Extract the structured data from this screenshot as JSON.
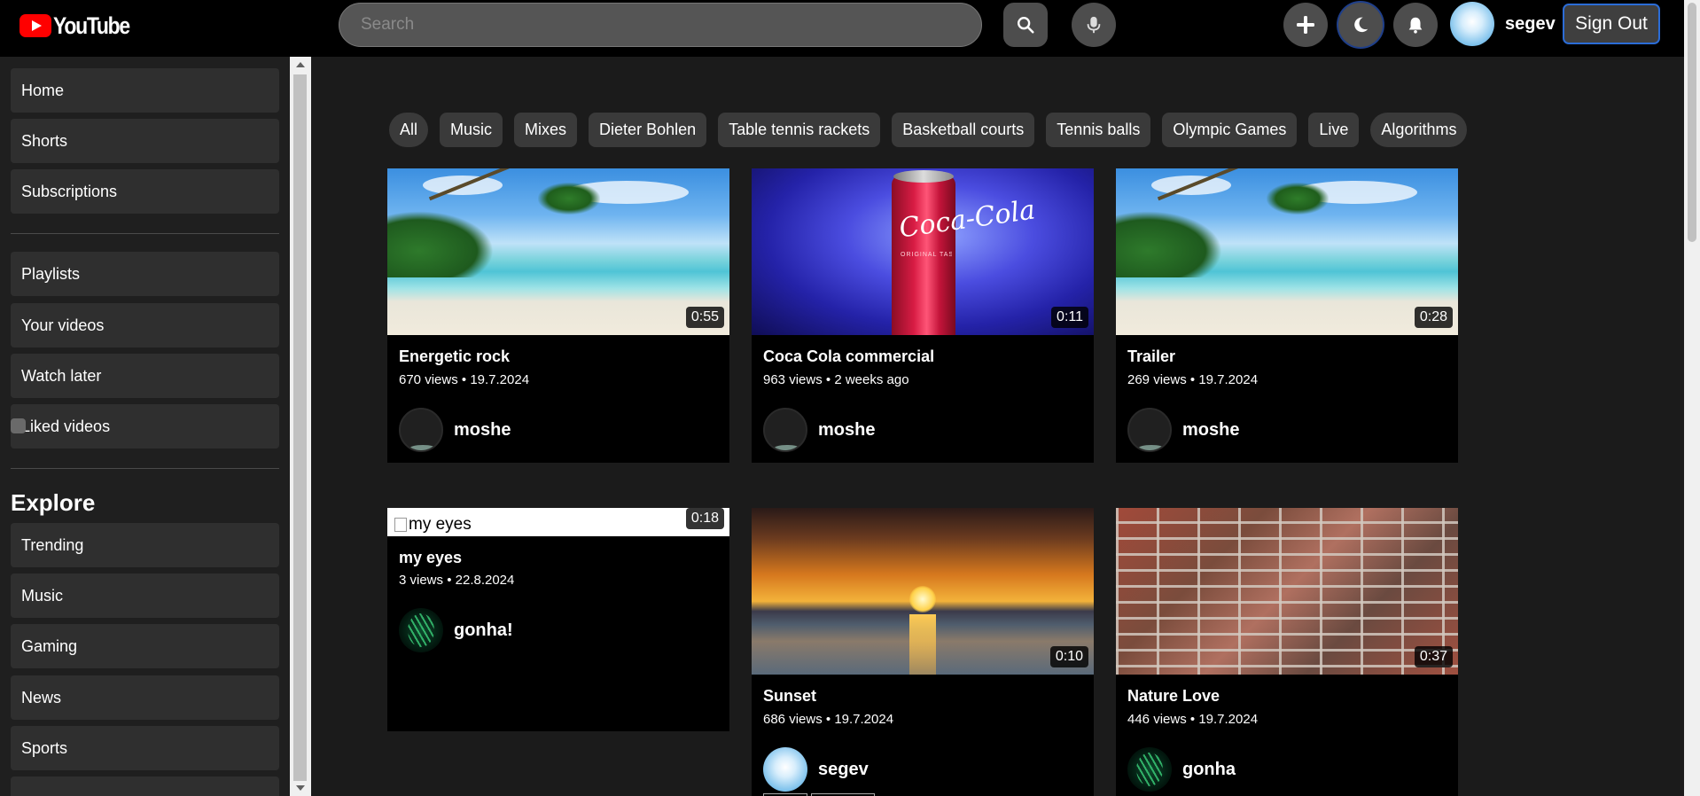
{
  "app": {
    "logo_text": "YouTube",
    "brand_color": "#ff0000"
  },
  "header": {
    "search_placeholder": "Search",
    "username": "segev",
    "signout_label": "Sign Out",
    "icons": [
      "search-icon",
      "microphone-icon",
      "plus-icon",
      "moon-icon",
      "bell-icon"
    ]
  },
  "sidebar": {
    "group1": [
      "Home",
      "Shorts",
      "Subscriptions"
    ],
    "group2": [
      "Playlists",
      "Your videos",
      "Watch later",
      "Liked videos"
    ],
    "explore_heading": "Explore",
    "group3": [
      "Trending",
      "Music",
      "Gaming",
      "News",
      "Sports"
    ]
  },
  "chips": [
    "All",
    "Music",
    "Mixes",
    "Dieter Bohlen",
    "Table tennis rackets",
    "Basketball courts",
    "Tennis balls",
    "Olympic Games",
    "Live",
    "Algorithms"
  ],
  "videos": [
    {
      "title": "Energetic rock",
      "views": "670 views",
      "date": "19.7.2024",
      "duration": "0:55",
      "channel": "moshe",
      "thumb": "beach"
    },
    {
      "title": "Coca Cola commercial",
      "views": "963 views",
      "date": "2 weeks ago",
      "duration": "0:11",
      "channel": "moshe",
      "thumb": "coke"
    },
    {
      "title": "Trailer",
      "views": "269 views",
      "date": "19.7.2024",
      "duration": "0:28",
      "channel": "moshe",
      "thumb": "beach"
    },
    {
      "title": "my eyes",
      "views": "3 views",
      "date": "22.8.2024",
      "duration": "0:18",
      "channel": "gonha!",
      "thumb": "broken",
      "alt": "my eyes"
    },
    {
      "title": "Sunset",
      "views": "686 views",
      "date": "19.7.2024",
      "duration": "0:10",
      "channel": "segev",
      "thumb": "sunset"
    },
    {
      "title": "Nature Love",
      "views": "446 views",
      "date": "19.7.2024",
      "duration": "0:37",
      "channel": "gonha",
      "thumb": "bricks"
    }
  ],
  "video_meta_separator": "•",
  "coke_can_text": "Coca-Cola",
  "coke_can_subtext": "ORIGINAL TASTE"
}
